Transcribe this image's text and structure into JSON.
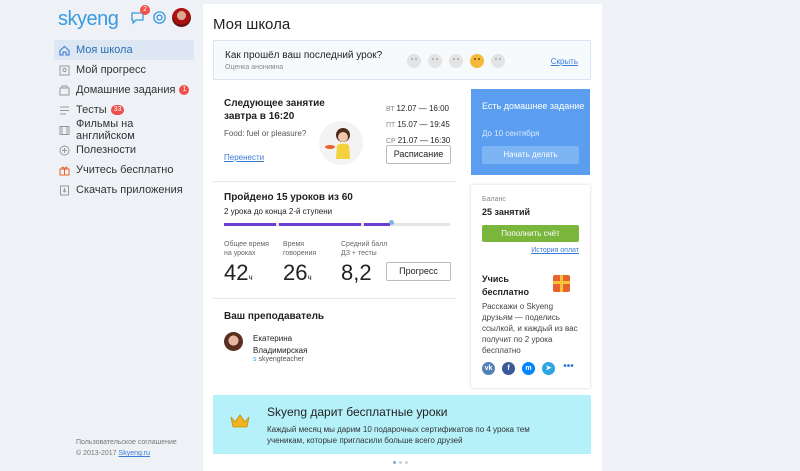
{
  "header": {
    "logo": "skyeng",
    "chat_badge": "2"
  },
  "sidebar": {
    "items": [
      {
        "label": "Моя школа",
        "icon": "home-icon",
        "active": true
      },
      {
        "label": "Мой прогресс",
        "icon": "progress-icon"
      },
      {
        "label": "Домашние задания",
        "icon": "homework-icon",
        "badge": "1"
      },
      {
        "label": "Тесты",
        "icon": "tests-icon",
        "badge": "33"
      },
      {
        "label": "Фильмы на английском",
        "icon": "film-icon"
      },
      {
        "label": "Полезности",
        "icon": "plus-circle-icon"
      },
      {
        "label": "Учитесь бесплатно",
        "icon": "gift-icon"
      },
      {
        "label": "Скачать приложения",
        "icon": "download-icon"
      }
    ],
    "footer_terms": "Пользовательское соглашение",
    "footer_copy": "© 2013-2017",
    "footer_link": "Skyeng.ru"
  },
  "main": {
    "title": "Моя школа",
    "survey": {
      "question": "Как прошёл ваш последний урок?",
      "note": "Оценка анонимна",
      "hide": "Скрыть"
    },
    "next_lesson": {
      "title": "Следующее занятие завтра в 16:20",
      "topic": "Food: fuel or pleasure?",
      "reschedule": "Перенести",
      "schedule": [
        {
          "day": "ВТ",
          "time": "12.07 — 16:00"
        },
        {
          "day": "ПТ",
          "time": "15.07 — 19:45"
        },
        {
          "day": "СР",
          "time": "21.07 — 16:30"
        }
      ],
      "schedule_button": "Расписание"
    },
    "progress": {
      "title": "Пройдено 15 уроков из 60",
      "subtitle": "2 урока до конца 2-й ступени",
      "stats": [
        {
          "label": "Общее время на уроках",
          "value": "42",
          "unit": "ч"
        },
        {
          "label": "Время говорения",
          "value": "26",
          "unit": "ч"
        },
        {
          "label": "Средний балл ДЗ + тесты",
          "value": "8,2",
          "unit": ""
        }
      ],
      "button": "Прогресс"
    },
    "teacher": {
      "heading": "Ваш преподаватель",
      "name_line1": "Екатерина",
      "name_line2": "Владимирская",
      "skype": "skyengteacher"
    },
    "homework": {
      "title": "Есть домашнее задание",
      "due": "До 10 сентября",
      "button": "Начать делать"
    },
    "balance": {
      "label": "Баланс",
      "value": "25 занятий",
      "pay_button": "Пополнить счёт",
      "history": "История оплат",
      "free_title": "Учись бесплатно",
      "free_desc": "Расскажи о Skyeng друзьям — поделись ссылкой, и каждый из вас получит по 2 урока бесплатно",
      "socials": [
        {
          "name": "vk",
          "glyph": "vk",
          "color": "#5181b8"
        },
        {
          "name": "facebook",
          "glyph": "f",
          "color": "#3b5998"
        },
        {
          "name": "messenger",
          "glyph": "m",
          "color": "#0084ff"
        },
        {
          "name": "telegram",
          "glyph": "➤",
          "color": "#2ca5e0"
        }
      ],
      "more": "•••"
    },
    "promo": {
      "title": "Skyeng дарит бесплатные уроки",
      "desc": "Каждый месяц мы дарим 10 подарочных сертификатов по 4 урока тем ученикам, которые пригласили больше всего друзей"
    }
  }
}
